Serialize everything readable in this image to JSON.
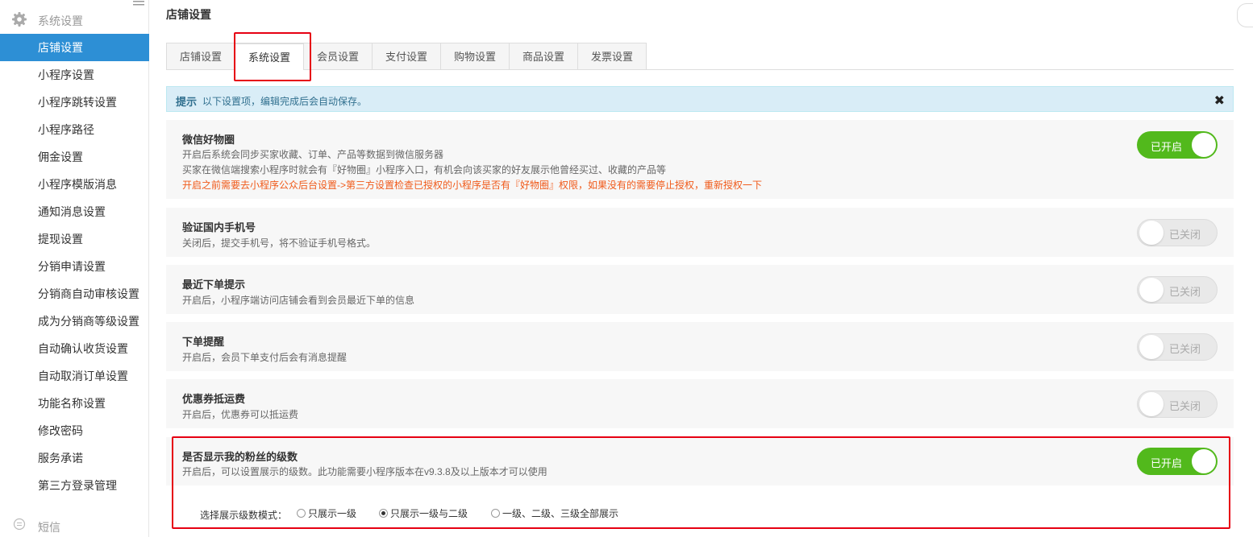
{
  "sidebar": {
    "group_label": "系统设置",
    "items": [
      {
        "label": "店铺设置",
        "active": true
      },
      {
        "label": "小程序设置"
      },
      {
        "label": "小程序跳转设置"
      },
      {
        "label": "小程序路径"
      },
      {
        "label": "佣金设置"
      },
      {
        "label": "小程序模版消息"
      },
      {
        "label": "通知消息设置"
      },
      {
        "label": "提现设置"
      },
      {
        "label": "分销申请设置"
      },
      {
        "label": "分销商自动审核设置"
      },
      {
        "label": "成为分销商等级设置"
      },
      {
        "label": "自动确认收货设置"
      },
      {
        "label": "自动取消订单设置"
      },
      {
        "label": "功能名称设置"
      },
      {
        "label": "修改密码"
      },
      {
        "label": "服务承诺"
      },
      {
        "label": "第三方登录管理"
      }
    ],
    "sms_label": "短信"
  },
  "main": {
    "page_title": "店铺设置",
    "tabs": [
      {
        "label": "店铺设置"
      },
      {
        "label": "系统设置",
        "active": true
      },
      {
        "label": "会员设置"
      },
      {
        "label": "支付设置"
      },
      {
        "label": "购物设置"
      },
      {
        "label": "商品设置"
      },
      {
        "label": "发票设置"
      }
    ],
    "alert": {
      "strong": "提示",
      "text": "以下设置项，编辑完成后会自动保存。",
      "close": "✖"
    },
    "settings": [
      {
        "title": "微信好物圈",
        "desc1": "开启后系统会同步买家收藏、订单、产品等数据到微信服务器",
        "desc2": "买家在微信端搜索小程序时就会有『好物圈』小程序入口，有机会向该买家的好友展示他曾经买过、收藏的产品等",
        "warn": "开启之前需要去小程序公众后台设置->第三方设置检查已授权的小程序是否有『好物圈』权限，如果没有的需要停止授权，重新授权一下",
        "switch_label": "已开启",
        "on": true
      },
      {
        "title": "验证国内手机号",
        "desc1": "关闭后，提交手机号，将不验证手机号格式。",
        "switch_label": "已关闭",
        "on": false
      },
      {
        "title": "最近下单提示",
        "desc1": "开启后，小程序端访问店铺会看到会员最近下单的信息",
        "switch_label": "已关闭",
        "on": false
      },
      {
        "title": "下单提醒",
        "desc1": "开启后，会员下单支付后会有消息提醒",
        "switch_label": "已关闭",
        "on": false
      },
      {
        "title": "优惠券抵运费",
        "desc1": "开启后，优惠券可以抵运费",
        "switch_label": "已关闭",
        "on": false
      },
      {
        "title": "是否显示我的粉丝的级数",
        "desc1": "开启后，可以设置展示的级数。此功能需要小程序版本在v9.3.8及以上版本才可以使用",
        "switch_label": "已开启",
        "on": true
      }
    ],
    "level_mode": {
      "label": "选择展示级数模式：",
      "options": [
        {
          "label": "只展示一级"
        },
        {
          "label": "只展示一级与二级",
          "checked": true
        },
        {
          "label": "一级、二级、三级全部展示"
        }
      ]
    }
  },
  "colors": {
    "sidebar_active": "#2d8fd5",
    "switch_on": "#52b91c",
    "warn_text": "#f05a1a",
    "highlight_border": "#e60012",
    "alert_bg": "#d9edf7"
  },
  "icons": {
    "group": "gear-icon",
    "sms": "message-icon",
    "collapse": "menu-lines-icon",
    "alert_close": "close-icon"
  }
}
